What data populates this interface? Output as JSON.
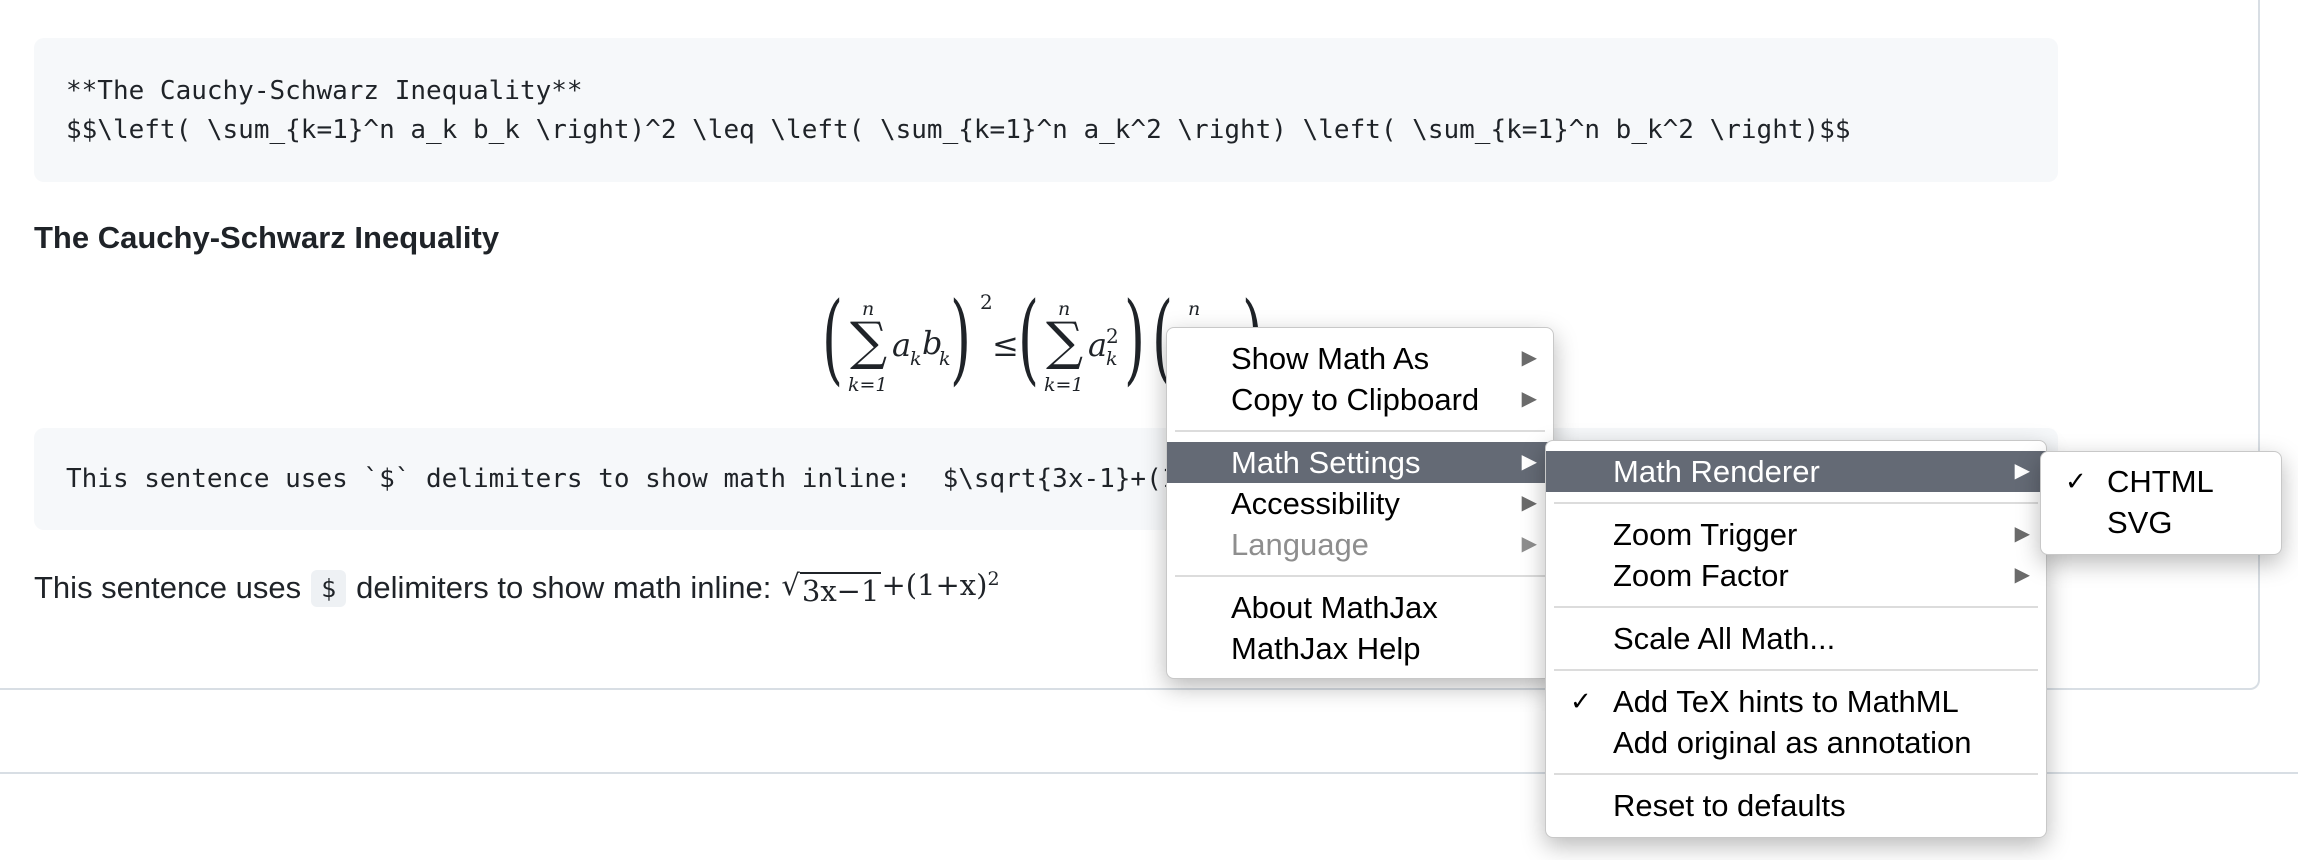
{
  "code_block_1": {
    "line1": "**The Cauchy-Schwarz Inequality**",
    "line2": "$$\\left( \\sum_{k=1}^n a_k b_k \\right)^2 \\leq \\left( \\sum_{k=1}^n a_k^2 \\right) \\left( \\sum_{k=1}^n b_k^2 \\right)$$"
  },
  "heading": "The Cauchy-Schwarz Inequality",
  "display_math": {
    "sum_upper": "n",
    "sum_lower": "k=1",
    "term1_a": "a",
    "term1_a_sub": "k",
    "term1_b": "b",
    "term1_b_sub": "k",
    "outer_exponent": "2",
    "relation": "≤",
    "term2_a": "a",
    "term2_a_sub": "k",
    "term2_a_sup": "2",
    "term3_upper": "n"
  },
  "code_block_2": {
    "text": "This sentence uses `$` delimiters to show math inline:  $\\sqrt{3x-1}+(1+x)^2$"
  },
  "sentence": {
    "before": "This sentence uses",
    "code": "$",
    "after": "delimiters to show math inline:",
    "radicand": "3x−1",
    "rest": "+(1+x)",
    "exponent": "2"
  },
  "context_menu": {
    "items": [
      {
        "label": "Show Math As",
        "submenu": true
      },
      {
        "label": "Copy to Clipboard",
        "submenu": true
      },
      {
        "label": "Math Settings",
        "submenu": true,
        "active": true
      },
      {
        "label": "Accessibility",
        "submenu": true
      },
      {
        "label": "Language",
        "submenu": true,
        "disabled": true
      },
      {
        "label": "About MathJax"
      },
      {
        "label": "MathJax Help"
      }
    ]
  },
  "math_settings_menu": {
    "items": [
      {
        "label": "Math Renderer",
        "submenu": true,
        "active": true
      },
      {
        "label": "Zoom Trigger",
        "submenu": true
      },
      {
        "label": "Zoom Factor",
        "submenu": true
      },
      {
        "label": "Scale All Math..."
      },
      {
        "label": "Add TeX hints to MathML",
        "checked": true
      },
      {
        "label": "Add original as annotation"
      },
      {
        "label": "Reset to defaults"
      }
    ]
  },
  "renderer_menu": {
    "items": [
      {
        "label": "CHTML",
        "checked": true
      },
      {
        "label": "SVG"
      }
    ]
  },
  "glyphs": {
    "submenu_arrow": "▶",
    "checkmark": "✓",
    "sigma": "∑",
    "left_paren": "(",
    "right_paren": ")",
    "sqrt": "√"
  }
}
